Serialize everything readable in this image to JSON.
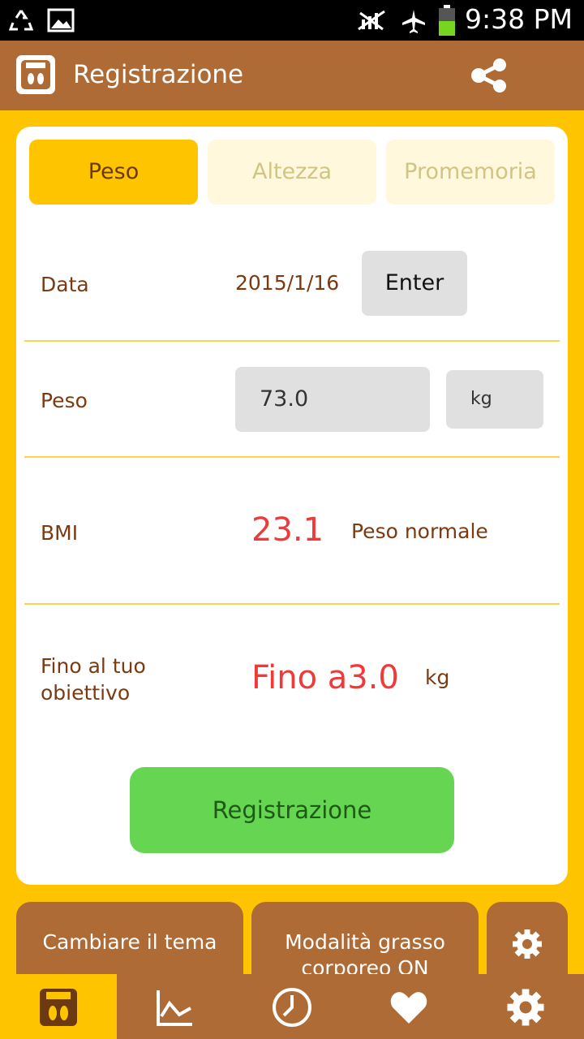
{
  "status_bar": {
    "time": "9:38 PM",
    "icons": [
      "recycle-icon",
      "image-icon",
      "no-signal-icon",
      "airplane-icon",
      "battery-icon"
    ]
  },
  "app_bar": {
    "title": "Registrazione",
    "icons": [
      "scale-logo-icon",
      "share-icon"
    ]
  },
  "tabs": [
    {
      "label": "Peso",
      "active": true
    },
    {
      "label": "Altezza",
      "active": false
    },
    {
      "label": "Promemoria",
      "active": false
    }
  ],
  "form": {
    "date_label": "Data",
    "date_value": "2015/1/16",
    "enter_label": "Enter",
    "weight_label": "Peso",
    "weight_value": "73.0",
    "weight_unit": "kg",
    "bmi_label": "BMI",
    "bmi_value": "23.1",
    "bmi_status": "Peso normale",
    "goal_label_line1": "Fino al tuo",
    "goal_label_line2": "obiettivo",
    "goal_value": "Fino a3.0",
    "goal_unit": "kg"
  },
  "register_button": "Registrazione",
  "bottom_buttons": {
    "theme": "Cambiare il tema",
    "fat_mode_line1": "Modalità grasso",
    "fat_mode_line2": "corporeo ON"
  },
  "bottom_nav": [
    "scale-icon",
    "chart-icon",
    "clock-icon",
    "heart-icon",
    "settings-icon"
  ],
  "colors": {
    "brown": "#ae6b35",
    "yellow": "#ffc400",
    "green": "#65d552",
    "red": "#f03a3a"
  }
}
